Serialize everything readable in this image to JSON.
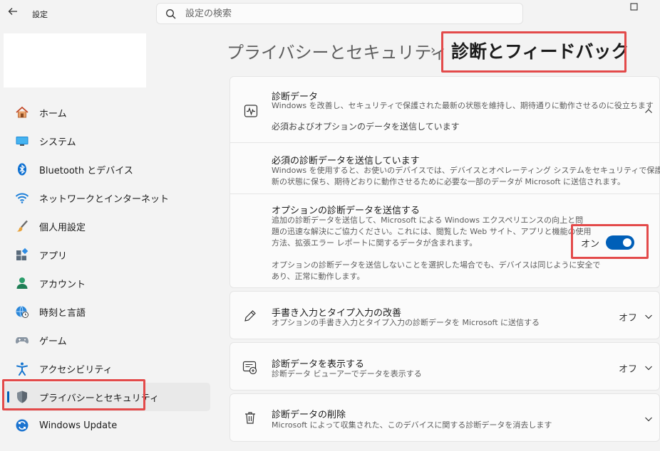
{
  "window": {
    "title": "設定"
  },
  "search": {
    "placeholder": "設定の検索"
  },
  "sidebar": {
    "items": [
      {
        "label": "ホーム"
      },
      {
        "label": "システム"
      },
      {
        "label": "Bluetooth とデバイス"
      },
      {
        "label": "ネットワークとインターネット"
      },
      {
        "label": "個人用設定"
      },
      {
        "label": "アプリ"
      },
      {
        "label": "アカウント"
      },
      {
        "label": "時刻と言語"
      },
      {
        "label": "ゲーム"
      },
      {
        "label": "アクセシビリティ"
      },
      {
        "label": "プライバシーとセキュリティ"
      },
      {
        "label": "Windows Update"
      }
    ],
    "selected_index": 10
  },
  "header": {
    "breadcrumb_parent": "プライバシーとセキュリティ",
    "separator": "›",
    "title": "診断とフィードバック"
  },
  "diagnostic_data": {
    "title": "診断データ",
    "description": "Windows を改善し、セキュリティで保護された最新の状態を維持し、期待通りに動作させるのに役立ちます",
    "status": "必須およびオプションのデータを送信しています",
    "required": {
      "title": "必須の診断データを送信しています",
      "description_line1": "Windows を使用すると、お使いのデバイスでは、デバイスとオペレーティング システムをセキュリティで保護し、最",
      "description_line2": "新の状態に保ち、期待どおりに動作させるために必要な一部のデータが Microsoft に送信されます。"
    },
    "optional": {
      "title": "オプションの診断データを送信する",
      "description_line1": "追加の診断データを送信して、Microsoft による Windows エクスペリエンスの向上と問",
      "description_line2": "題の迅速な解決にご協力ください。これには、閲覧した Web サイト、アプリと機能の使用",
      "description_line3": "方法、拡張エラー レポートに関するデータが含まれます。",
      "note_line1": "オプションの診断データを送信しないことを選択した場合でも、デバイスは同じように安全で",
      "note_line2": "あり、正常に動作します。",
      "toggle_label": "オン",
      "toggle_on": true
    }
  },
  "inking": {
    "title": "手書き入力とタイプ入力の改善",
    "description": "オプションの手書き入力とタイプ入力の診断データを Microsoft に送信する",
    "state": "オフ"
  },
  "view_data": {
    "title": "診断データを表示する",
    "description": "診断データ ビューアーでデータを表示する",
    "state": "オフ"
  },
  "delete_data": {
    "title": "診断データの削除",
    "description": "Microsoft によって収集された、このデバイスに関する診断データを消去します"
  },
  "colors": {
    "accent": "#005fb8",
    "highlight": "#e34a4a"
  }
}
